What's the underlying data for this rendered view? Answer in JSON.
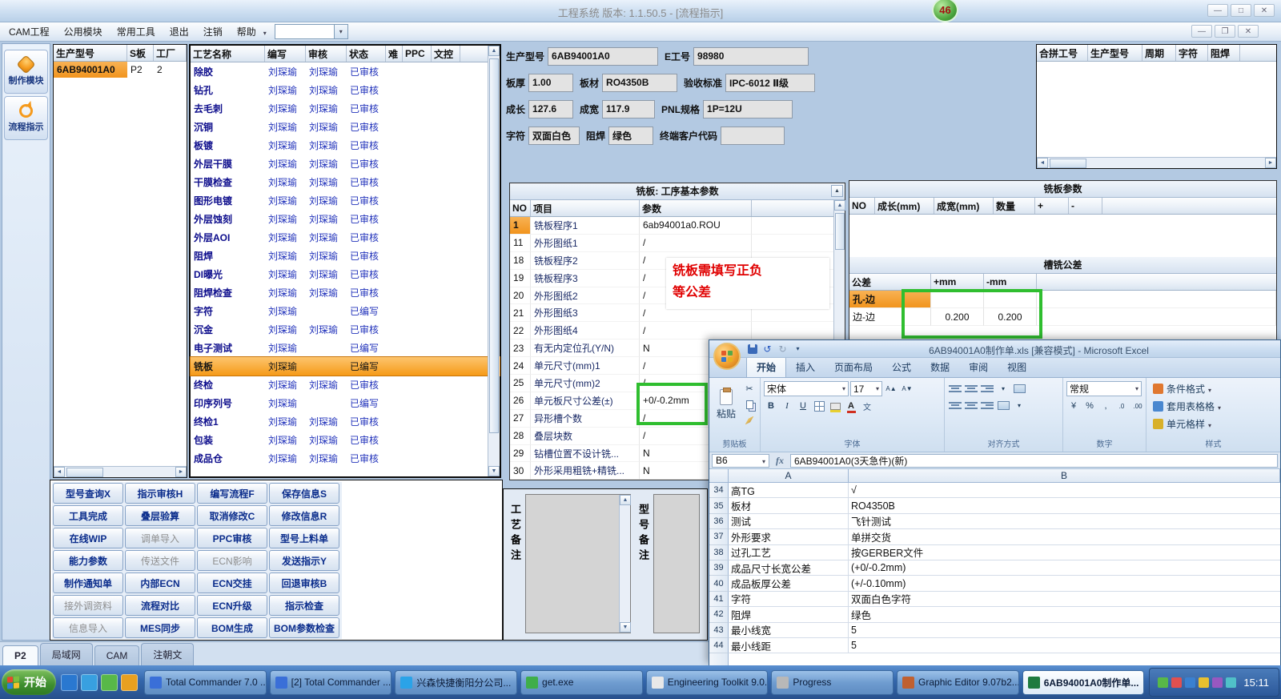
{
  "titlebar": {
    "title": "工程系统  版本: 1.1.50.5 - [流程指示]",
    "badge": "46"
  },
  "menubar": {
    "items": [
      "CAM工程",
      "公用模块",
      "常用工具",
      "退出",
      "注销",
      "帮助"
    ]
  },
  "sidebar": {
    "buttons": [
      {
        "label": "制作模块"
      },
      {
        "label": "流程指示"
      }
    ]
  },
  "product_list": {
    "headers": [
      "生产型号",
      "S板",
      "工厂"
    ],
    "rows": [
      {
        "model": "6AB94001A0",
        "sboard": "P2",
        "factory": "2",
        "state": "selected"
      }
    ]
  },
  "process_table": {
    "headers": [
      "工艺名称",
      "编写",
      "审核",
      "状态",
      "难",
      "PPC",
      "文控"
    ],
    "rows": [
      {
        "name": "除胶",
        "writer": "刘琛瑜",
        "reviewer": "刘琛瑜",
        "status": "已审核"
      },
      {
        "name": "钻孔",
        "writer": "刘琛瑜",
        "reviewer": "刘琛瑜",
        "status": "已审核"
      },
      {
        "name": "去毛刺",
        "writer": "刘琛瑜",
        "reviewer": "刘琛瑜",
        "status": "已审核"
      },
      {
        "name": "沉铜",
        "writer": "刘琛瑜",
        "reviewer": "刘琛瑜",
        "status": "已审核"
      },
      {
        "name": "板镀",
        "writer": "刘琛瑜",
        "reviewer": "刘琛瑜",
        "status": "已审核"
      },
      {
        "name": "外层干膜",
        "writer": "刘琛瑜",
        "reviewer": "刘琛瑜",
        "status": "已审核"
      },
      {
        "name": "干膜检查",
        "writer": "刘琛瑜",
        "reviewer": "刘琛瑜",
        "status": "已审核"
      },
      {
        "name": "图形电镀",
        "writer": "刘琛瑜",
        "reviewer": "刘琛瑜",
        "status": "已审核"
      },
      {
        "name": "外层蚀刻",
        "writer": "刘琛瑜",
        "reviewer": "刘琛瑜",
        "status": "已审核"
      },
      {
        "name": "外层AOI",
        "writer": "刘琛瑜",
        "reviewer": "刘琛瑜",
        "status": "已审核"
      },
      {
        "name": "阻焊",
        "writer": "刘琛瑜",
        "reviewer": "刘琛瑜",
        "status": "已审核"
      },
      {
        "name": "DI曝光",
        "writer": "刘琛瑜",
        "reviewer": "刘琛瑜",
        "status": "已审核"
      },
      {
        "name": "阻焊检查",
        "writer": "刘琛瑜",
        "reviewer": "刘琛瑜",
        "status": "已审核"
      },
      {
        "name": "字符",
        "writer": "刘琛瑜",
        "reviewer": "",
        "status": "已编写"
      },
      {
        "name": "沉金",
        "writer": "刘琛瑜",
        "reviewer": "刘琛瑜",
        "status": "已审核"
      },
      {
        "name": "电子测试",
        "writer": "刘琛瑜",
        "reviewer": "",
        "status": "已编写"
      },
      {
        "name": "铣板",
        "writer": "刘琛瑜",
        "reviewer": "",
        "status": "已编写",
        "state": "selected"
      },
      {
        "name": "终检",
        "writer": "刘琛瑜",
        "reviewer": "刘琛瑜",
        "status": "已审核"
      },
      {
        "name": "印序列号",
        "writer": "刘琛瑜",
        "reviewer": "",
        "status": "已编写"
      },
      {
        "name": "终检1",
        "writer": "刘琛瑜",
        "reviewer": "刘琛瑜",
        "status": "已审核"
      },
      {
        "name": "包装",
        "writer": "刘琛瑜",
        "reviewer": "刘琛瑜",
        "status": "已审核"
      },
      {
        "name": "成品仓",
        "writer": "刘琛瑜",
        "reviewer": "刘琛瑜",
        "status": "已审核"
      }
    ]
  },
  "action_buttons": [
    {
      "label": "型号查询X"
    },
    {
      "label": "指示审核H"
    },
    {
      "label": "编写流程F"
    },
    {
      "label": "保存信息S"
    },
    {
      "label": "工具完成"
    },
    {
      "label": "叠层验算"
    },
    {
      "label": "取消修改C"
    },
    {
      "label": "修改信息R"
    },
    {
      "label": "在线WIP"
    },
    {
      "label": "调单导入",
      "state": "disabled"
    },
    {
      "label": "PPC审核"
    },
    {
      "label": "型号上料单"
    },
    {
      "label": "能力参数"
    },
    {
      "label": "传送文件",
      "state": "disabled"
    },
    {
      "label": "ECN影响",
      "state": "disabled"
    },
    {
      "label": "发送指示Y"
    },
    {
      "label": "制作通知单"
    },
    {
      "label": "内部ECN"
    },
    {
      "label": "ECN交挂"
    },
    {
      "label": "回退审核B"
    },
    {
      "label": "接外调资料",
      "state": "disabled"
    },
    {
      "label": "流程对比"
    },
    {
      "label": "ECN升级"
    },
    {
      "label": "指示检查"
    },
    {
      "label": "信息导入",
      "state": "disabled"
    },
    {
      "label": "MES同步"
    },
    {
      "label": "BOM生成"
    },
    {
      "label": "BOM参数检查"
    }
  ],
  "remarks": {
    "process_label": "工艺备注",
    "model_label": "型号备注"
  },
  "info_form": {
    "labels": {
      "model": "生产型号",
      "ecode": "E工号",
      "thickness": "板厚",
      "material": "板材",
      "standard": "验收标准",
      "length": "成长",
      "width": "成宽",
      "pnl": "PNL规格",
      "legend": "字符",
      "mask": "阻焊",
      "customer": "终端客户代码"
    },
    "values": {
      "model": "6AB94001A0",
      "ecode": "98980",
      "thickness": "1.00",
      "material": "RO4350B",
      "standard": "IPC-6012 Ⅱ级",
      "length": "127.6",
      "width": "117.9",
      "pnl": "1P=12U",
      "legend": "双面白色",
      "mask": "绿色",
      "customer": ""
    }
  },
  "merge_table": {
    "headers": [
      "合拼工号",
      "生产型号",
      "周期",
      "字符",
      "阻焊"
    ]
  },
  "mill_basic": {
    "title": "铣板: 工序基本参数",
    "headers": [
      "NO",
      "项目",
      "参数"
    ],
    "rows": [
      {
        "no": "1",
        "item": "铣板程序1",
        "value": "6ab94001a0.ROU",
        "state": "first"
      },
      {
        "no": "11",
        "item": "外形图纸1",
        "value": "/"
      },
      {
        "no": "18",
        "item": "铣板程序2",
        "value": "/"
      },
      {
        "no": "19",
        "item": "铣板程序3",
        "value": "/"
      },
      {
        "no": "20",
        "item": "外形图纸2",
        "value": "/"
      },
      {
        "no": "21",
        "item": "外形图纸3",
        "value": "/"
      },
      {
        "no": "22",
        "item": "外形图纸4",
        "value": "/"
      },
      {
        "no": "23",
        "item": "有无内定位孔(Y/N)",
        "value": "N"
      },
      {
        "no": "24",
        "item": "单元尺寸(mm)1",
        "value": "/"
      },
      {
        "no": "25",
        "item": "单元尺寸(mm)2",
        "value": "/"
      },
      {
        "no": "26",
        "item": "单元板尺寸公差(±)",
        "value": "+0/-0.2mm"
      },
      {
        "no": "27",
        "item": "异形槽个数",
        "value": "/"
      },
      {
        "no": "28",
        "item": "叠层块数",
        "value": "/"
      },
      {
        "no": "29",
        "item": "钻槽位置不设计铣...",
        "value": "N"
      },
      {
        "no": "30",
        "item": "外形采用粗铣+精铣...",
        "value": "N"
      }
    ]
  },
  "mill_params": {
    "title": "铣板参数",
    "headers": [
      "NO",
      "成长(mm)",
      "成宽(mm)",
      "数量",
      "+",
      "-"
    ],
    "slot": {
      "title": "槽铣公差",
      "headers": [
        "公差",
        "+mm",
        "-mm"
      ],
      "rows": [
        {
          "name": "孔-边",
          "plus": "",
          "minus": "",
          "state": "selected"
        },
        {
          "name": "边-边",
          "plus": "0.200",
          "minus": "0.200"
        }
      ]
    }
  },
  "annotation": {
    "line1": "铣板需填写正负",
    "line2": "等公差"
  },
  "excel": {
    "title": "6AB94001A0制作单.xls [兼容模式] - Microsoft Excel",
    "tabs": [
      {
        "label": "开始",
        "state": "active"
      },
      {
        "label": "插入"
      },
      {
        "label": "页面布局"
      },
      {
        "label": "公式"
      },
      {
        "label": "数据"
      },
      {
        "label": "审阅"
      },
      {
        "label": "视图"
      }
    ],
    "ribbon": {
      "paste_label": "粘贴",
      "font_name": "宋体",
      "font_size": "17",
      "number_format": "常规",
      "group_labels": [
        "剪贴板",
        "字体",
        "对齐方式",
        "数字",
        "样式"
      ],
      "style_buttons": [
        {
          "label": "条件格式",
          "icon": "#e07830"
        },
        {
          "label": "套用表格格",
          "icon": "#4a88d0"
        },
        {
          "label": "单元格样",
          "icon": "#d8b028"
        }
      ]
    },
    "formula_bar": {
      "name_box": "B6",
      "formula": "6AB94001A0(3天急件)(新)"
    },
    "sheet": {
      "col_headers": [
        "A",
        "B"
      ],
      "rows": [
        {
          "num": "34",
          "a": "高TG",
          "b": "√"
        },
        {
          "num": "35",
          "a": "板材",
          "b": "RO4350B"
        },
        {
          "num": "36",
          "a": "测试",
          "b": "飞针测试"
        },
        {
          "num": "37",
          "a": "外形要求",
          "b": "单拼交货"
        },
        {
          "num": "38",
          "a": "过孔工艺",
          "b": "按GERBER文件"
        },
        {
          "num": "39",
          "a": "成品尺寸长宽公差",
          "b": "(+0/-0.2mm)"
        },
        {
          "num": "40",
          "a": "成品板厚公差",
          "b": "(+/-0.10mm)"
        },
        {
          "num": "41",
          "a": "字符",
          "b": "双面白色字符"
        },
        {
          "num": "42",
          "a": "阻焊",
          "b": "绿色"
        },
        {
          "num": "43",
          "a": "最小线宽",
          "b": "5"
        },
        {
          "num": "44",
          "a": "最小线距",
          "b": "5"
        }
      ]
    }
  },
  "bottom_tabs": [
    {
      "label": "P2",
      "state": "active"
    },
    {
      "label": "局域网"
    },
    {
      "label": "CAM"
    },
    {
      "label": "注朝文"
    }
  ],
  "taskbar": {
    "start": "开始",
    "quick_icons": [
      {
        "color": "#2a78d0"
      },
      {
        "color": "#38a0e0"
      },
      {
        "color": "#58b848"
      },
      {
        "color": "#e8a020"
      }
    ],
    "buttons": [
      {
        "label": "Total Commander 7.0 ...",
        "icon": "#3a6fd8"
      },
      {
        "label": "[2] Total Commander ...",
        "icon": "#3a6fd8"
      },
      {
        "label": "兴森快捷衡阳分公司...",
        "icon": "#2aa3e8"
      },
      {
        "label": "get.exe",
        "icon": "#3fae49"
      },
      {
        "label": "Engineering Toolkit 9.0...",
        "icon": "#e8e8e8"
      },
      {
        "label": "Progress",
        "icon": "#b8b8b8"
      },
      {
        "label": "Graphic Editor 9.07b2...",
        "icon": "#c06030"
      },
      {
        "label": "6AB94001A0制作单...",
        "icon": "#1f7a3f",
        "state": "active"
      }
    ],
    "tray_icons": [
      {
        "color": "#58b848"
      },
      {
        "color": "#e05050"
      },
      {
        "color": "#3a80d0"
      },
      {
        "color": "#e8c030"
      },
      {
        "color": "#9858c0"
      },
      {
        "color": "#50c0c8"
      }
    ],
    "tray_time": "15:11"
  }
}
